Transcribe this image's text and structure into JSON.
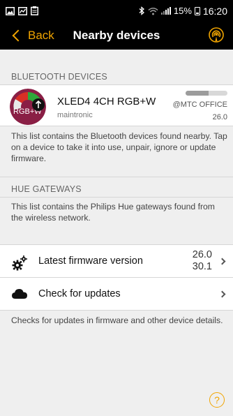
{
  "status_bar": {
    "battery_pct": "15%",
    "time": "16:20",
    "icons": [
      "image-icon",
      "chart-icon",
      "clipboard-icon",
      "bluetooth-icon",
      "wifi-icon",
      "signal-icon",
      "battery-icon"
    ]
  },
  "nav": {
    "back_label": "Back",
    "title": "Nearby devices",
    "action_icon": "broadcast-icon",
    "accent_color": "#f0a400"
  },
  "bluetooth": {
    "header": "BLUETOOTH DEVICES",
    "devices": [
      {
        "name": "XLED4 4CH RGB+W",
        "maker": "maintronic",
        "badge": "RGB+W",
        "location": "@MTC OFFICE",
        "version": "26.0",
        "signal_fraction": 0.55
      }
    ],
    "description": "This list contains the Bluetooth devices found nearby. Tap on a device to take it into use, unpair, ignore or update firmware."
  },
  "hue": {
    "header": "HUE GATEWAYS",
    "description": "This list contains the Philips Hue gateways found from the wireless network."
  },
  "firmware": {
    "latest_label": "Latest firmware version",
    "latest_value_1": "26.0",
    "latest_value_2": "30.1",
    "check_label": "Check for updates",
    "description": "Checks for updates in firmware and other device details."
  },
  "help": {
    "label": "?"
  }
}
